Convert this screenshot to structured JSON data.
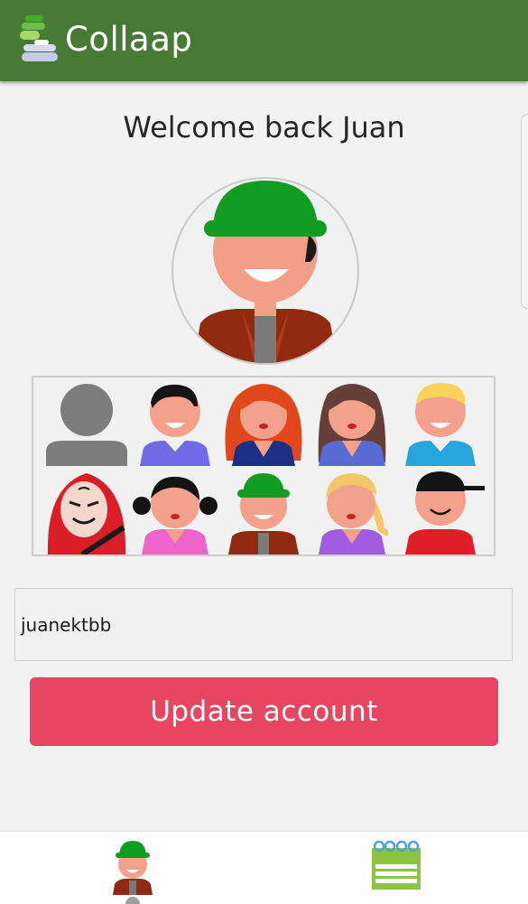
{
  "app": {
    "title": "Collaap",
    "logo_icon": "collaap-hands-logo"
  },
  "colors": {
    "appbar": "#467a35",
    "button": "#e84562",
    "background": "#f2f2f2",
    "hat_green": "#119d21"
  },
  "welcome": {
    "text": "Welcome back Juan"
  },
  "selected_avatar": "green-hat-boy",
  "avatars": [
    {
      "name": "default-silhouette"
    },
    {
      "name": "dark-hair-boy"
    },
    {
      "name": "red-hair-girl"
    },
    {
      "name": "brown-hair-girl"
    },
    {
      "name": "blond-boy"
    },
    {
      "name": "red-hood-mask"
    },
    {
      "name": "dark-bun-girl"
    },
    {
      "name": "green-hat-boy"
    },
    {
      "name": "blond-ponytail-girl"
    },
    {
      "name": "cap-boy"
    }
  ],
  "form": {
    "username": "juanektbb"
  },
  "actions": {
    "update_label": "Update account"
  },
  "nav": {
    "items": [
      {
        "icon": "profile-avatar-icon"
      },
      {
        "icon": "board-icon"
      }
    ]
  }
}
